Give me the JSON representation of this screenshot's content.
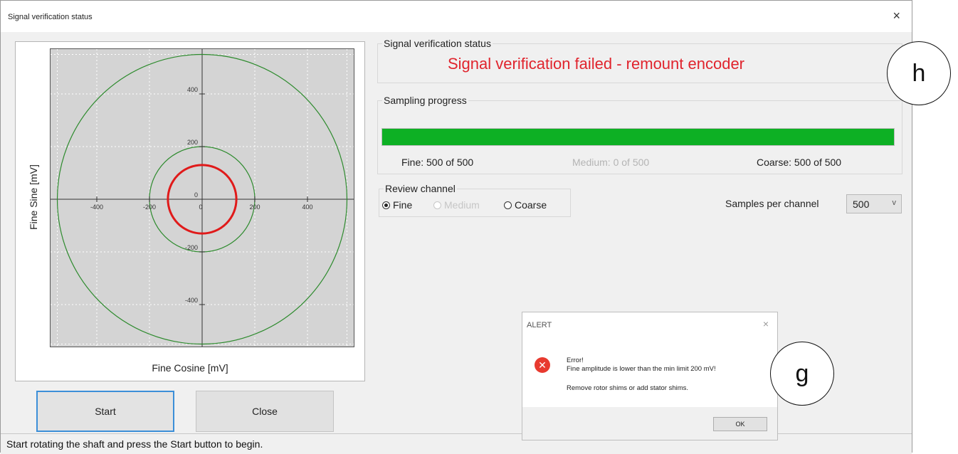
{
  "window": {
    "title": "Signal verification status",
    "close_glyph": "×"
  },
  "plot": {
    "xlabel": "Fine Cosine [mV]",
    "ylabel": "Fine Sine [mV]",
    "x_ticks": [
      "-400",
      "-200",
      "0",
      "200",
      "400"
    ],
    "y_ticks": [
      "400",
      "200",
      "0",
      "-200",
      "-400"
    ]
  },
  "chart_data": {
    "type": "scatter",
    "xlabel": "Fine Cosine [mV]",
    "ylabel": "Fine Sine [mV]",
    "xlim": [
      -550,
      550
    ],
    "ylim": [
      -550,
      550
    ],
    "grid": true,
    "limit_circles_radius_mv": [
      200,
      550
    ],
    "limit_circle_color": "#2e8b2e",
    "signal_radius_mv": 130,
    "signal_color": "#e01a1a"
  },
  "buttons": {
    "start": "Start",
    "close": "Close"
  },
  "status_bar": {
    "text": "Start rotating the shaft and press the Start button to begin."
  },
  "verification": {
    "legend": "Signal verification status",
    "message": "Signal verification failed - remount encoder",
    "message_color": "#e0242d"
  },
  "sampling": {
    "legend": "Sampling progress",
    "progress_fraction": 1.0,
    "progress_color": "#0db024",
    "fine": "Fine: 500 of 500",
    "medium": "Medium: 0 of 500",
    "coarse": "Coarse: 500 of 500"
  },
  "review": {
    "legend": "Review channel",
    "fine": "Fine",
    "medium": "Medium",
    "coarse": "Coarse",
    "selected": "Fine"
  },
  "samples": {
    "label": "Samples per channel",
    "value": "500",
    "chevron": "v"
  },
  "alert": {
    "title": "ALERT",
    "close_glyph": "×",
    "icon_glyph": "✕",
    "error_heading": "Error!",
    "error_line": "Fine amplitude is lower than the min limit 200 mV!",
    "advice": "Remove rotor shims or add stator shims.",
    "ok": "OK"
  },
  "callouts": {
    "h": "h",
    "g": "g"
  }
}
